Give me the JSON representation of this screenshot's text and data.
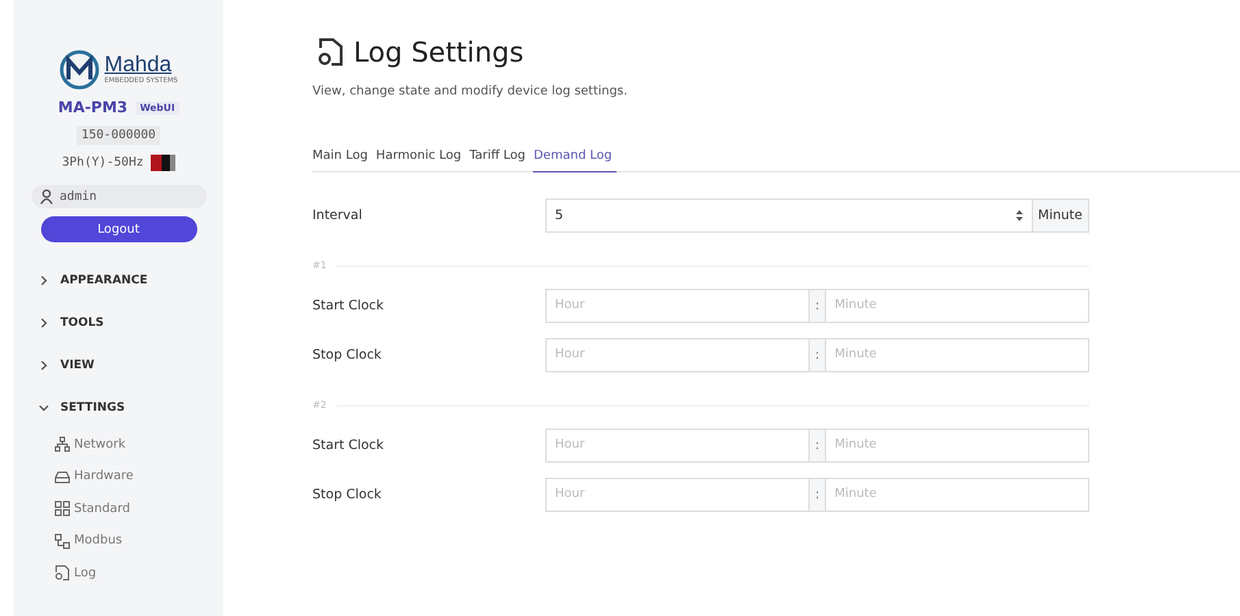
{
  "sidebar": {
    "logo": {
      "name": "Mahda",
      "tagline": "EMBEDDED SYSTEMS"
    },
    "device": {
      "model": "MA-PM3",
      "badge": "WebUI",
      "serial": "150-000000",
      "config": "3Ph(Y)-50Hz"
    },
    "user": "admin",
    "logout": "Logout",
    "menu": [
      {
        "label": "APPEARANCE",
        "expanded": false
      },
      {
        "label": "TOOLS",
        "expanded": false
      },
      {
        "label": "VIEW",
        "expanded": false
      },
      {
        "label": "SETTINGS",
        "expanded": true,
        "children": [
          {
            "label": "Network",
            "kind": "network"
          },
          {
            "label": "Hardware",
            "kind": "hardware"
          },
          {
            "label": "Standard",
            "kind": "standard"
          },
          {
            "label": "Modbus",
            "kind": "modbus"
          },
          {
            "label": "Log",
            "kind": "log"
          }
        ]
      }
    ]
  },
  "page": {
    "title": "Log Settings",
    "subtitle": "View, change state and modify device log settings.",
    "tabs": [
      {
        "label": "Main Log",
        "selected": false
      },
      {
        "label": "Harmonic Log",
        "selected": false
      },
      {
        "label": "Tariff Log",
        "selected": false
      },
      {
        "label": "Demand Log",
        "selected": true
      }
    ],
    "interval": {
      "label": "Interval",
      "value": "5",
      "unit": "Minute"
    },
    "groups": [
      {
        "title": "#1",
        "rows": [
          {
            "label": "Start Clock",
            "hour_placeholder": "Hour",
            "separator": ":",
            "minute_placeholder": "Minute"
          },
          {
            "label": "Stop Clock",
            "hour_placeholder": "Hour",
            "separator": ":",
            "minute_placeholder": "Minute"
          }
        ]
      },
      {
        "title": "#2",
        "rows": [
          {
            "label": "Start Clock",
            "hour_placeholder": "Hour",
            "separator": ":",
            "minute_placeholder": "Minute"
          },
          {
            "label": "Stop Clock",
            "hour_placeholder": "Hour",
            "separator": ":",
            "minute_placeholder": "Minute"
          }
        ]
      }
    ]
  }
}
